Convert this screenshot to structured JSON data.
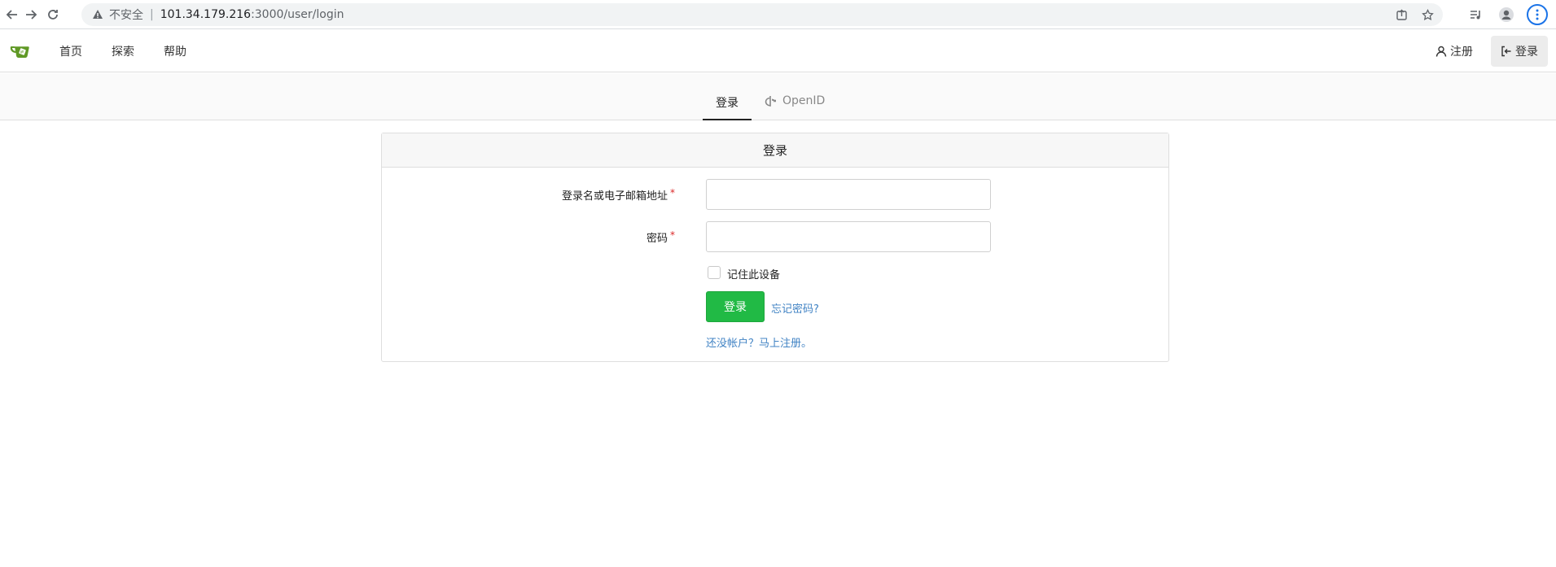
{
  "browser": {
    "insecure_label": "不安全",
    "url_host": "101.34.179.216",
    "url_path": ":3000/user/login"
  },
  "header": {
    "nav": [
      {
        "label": "首页"
      },
      {
        "label": "探索"
      },
      {
        "label": "帮助"
      }
    ],
    "register_label": "注册",
    "login_label": "登录"
  },
  "tabs": [
    {
      "label": "登录",
      "active": true
    },
    {
      "label": "OpenID",
      "active": false
    }
  ],
  "card": {
    "title": "登录",
    "username_label": "登录名或电子邮箱地址",
    "username_value": "",
    "password_label": "密码",
    "password_value": "",
    "required_mark": "*",
    "remember_label": "记住此设备",
    "remember_checked": false,
    "submit_label": "登录",
    "forgot_label": "忘记密码?",
    "signup_label": "还没帐户？马上注册。"
  },
  "colors": {
    "primary_green": "#21ba45",
    "link_blue": "#4183c4",
    "required_red": "#db2828",
    "logo_green": "#609926"
  }
}
